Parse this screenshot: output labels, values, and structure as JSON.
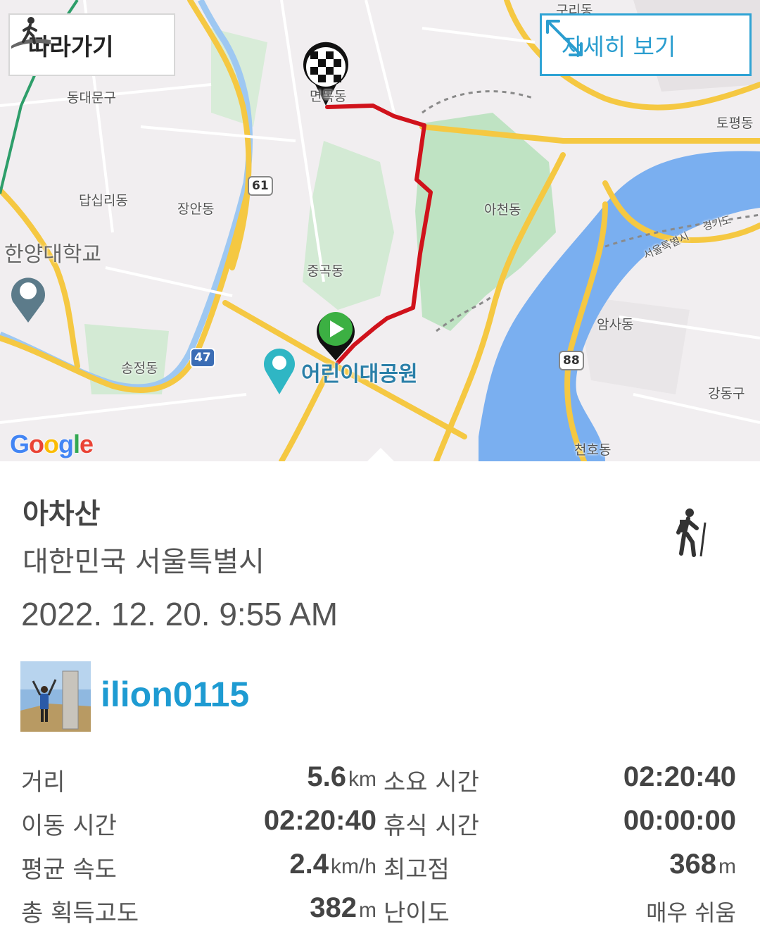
{
  "map": {
    "follow_label": "따라가기",
    "detail_label": "자세히 보기",
    "attribution": "Google",
    "labels": {
      "dongdaemun": "동대문구",
      "dapsimni": "답십리동",
      "jangan": "장안동",
      "hanyang": "한양대학교",
      "seongsu": "송정동",
      "junggok": "중곡동",
      "achon": "아천동",
      "amsa": "암사동",
      "gangdong": "강동구",
      "cheonho": "천호동",
      "topyeong": "토평동",
      "guri": "구리동",
      "myeonmok": "면목동",
      "gyeonggi": "경기도",
      "seoul_city": "서울특별시",
      "park": "어린이대공원"
    },
    "shields": {
      "r61": "61",
      "r47": "47",
      "r88": "88"
    }
  },
  "activity": {
    "title": "아차산",
    "region": "대한민국 서울특별시",
    "datetime": "2022. 12. 20. 9:55 AM",
    "activity_icon": "hiking-icon",
    "username": "ilion0115"
  },
  "stats": [
    {
      "label": "거리",
      "value": "5.6",
      "unit": "km",
      "label2": "소요 시간",
      "value2": "02:20:40",
      "unit2": ""
    },
    {
      "label": "이동 시간",
      "value": "02:20:40",
      "unit": "",
      "label2": "휴식 시간",
      "value2": "00:00:00",
      "unit2": ""
    },
    {
      "label": "평균 속도",
      "value": "2.4",
      "unit": "km/h",
      "label2": "최고점",
      "value2": "368",
      "unit2": "m"
    },
    {
      "label": "총 획득고도",
      "value": "382",
      "unit": "m",
      "label2": "난이도",
      "value2": "매우 쉬움",
      "unit2": ""
    }
  ],
  "colors": {
    "accent": "#2a9dcf",
    "route": "#d0121b",
    "water": "#7aaff0",
    "park": "#bfe3c3",
    "road": "#f5c842"
  }
}
